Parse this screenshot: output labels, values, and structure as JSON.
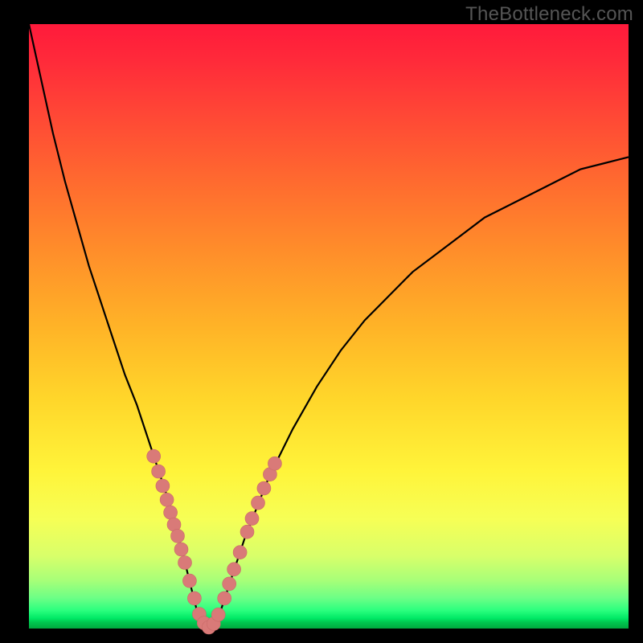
{
  "watermark": "TheBottleneck.com",
  "colors": {
    "frame": "#000000",
    "curve": "#000000",
    "marker_fill": "#d97a78",
    "marker_stroke": "#c96a68"
  },
  "chart_data": {
    "type": "line",
    "title": "",
    "xlabel": "",
    "ylabel": "",
    "xlim": [
      0,
      100
    ],
    "ylim": [
      0,
      100
    ],
    "grid": false,
    "legend": false,
    "annotations": [
      "TheBottleneck.com"
    ],
    "series": [
      {
        "name": "bottleneck-curve",
        "x": [
          0,
          2,
          4,
          6,
          8,
          10,
          12,
          14,
          16,
          18,
          20,
          22,
          24,
          26,
          27,
          28,
          29,
          30,
          31,
          32,
          34,
          36,
          38,
          40,
          44,
          48,
          52,
          56,
          60,
          64,
          68,
          72,
          76,
          80,
          84,
          88,
          92,
          96,
          100
        ],
        "values": [
          100,
          91,
          82,
          74,
          67,
          60,
          54,
          48,
          42,
          37,
          31,
          25,
          19,
          11,
          7,
          3,
          1,
          0,
          1,
          3,
          9,
          15,
          20,
          25,
          33,
          40,
          46,
          51,
          55,
          59,
          62,
          65,
          68,
          70,
          72,
          74,
          76,
          77,
          78
        ]
      }
    ],
    "markers": {
      "name": "highlight-points",
      "x": [
        20.8,
        21.6,
        22.3,
        23.0,
        23.6,
        24.2,
        24.8,
        25.4,
        26.0,
        26.8,
        27.6,
        28.4,
        29.2,
        30.0,
        30.8,
        31.6,
        32.6,
        33.4,
        34.2,
        35.2,
        36.4,
        37.2,
        38.2,
        39.2,
        40.2,
        41.0
      ],
      "values": [
        28.5,
        26.0,
        23.6,
        21.3,
        19.2,
        17.2,
        15.3,
        13.1,
        10.9,
        7.9,
        5.0,
        2.4,
        0.9,
        0.2,
        0.8,
        2.3,
        5.0,
        7.4,
        9.8,
        12.6,
        16.0,
        18.2,
        20.8,
        23.2,
        25.5,
        27.3
      ]
    }
  }
}
